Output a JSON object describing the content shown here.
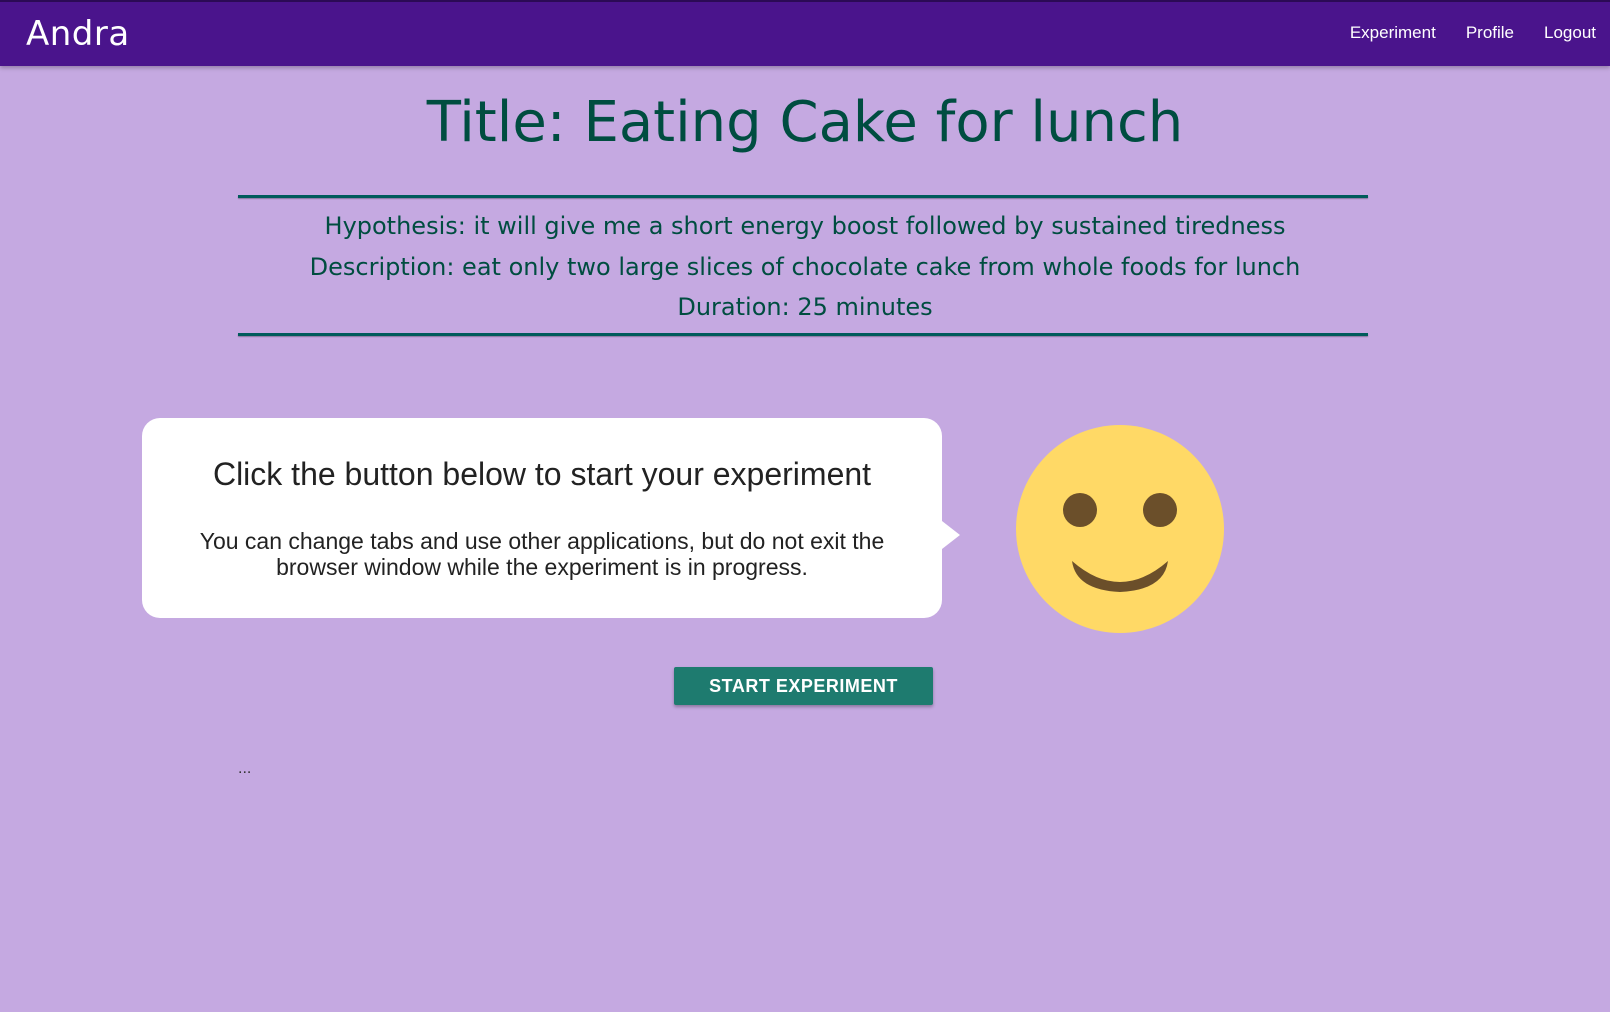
{
  "navbar": {
    "brand": "Andra",
    "links": [
      "Experiment",
      "Profile",
      "Logout"
    ]
  },
  "experiment": {
    "title": "Title: Eating Cake for lunch",
    "hypothesis": "Hypothesis: it will give me a short energy boost followed by sustained tiredness",
    "description": "Description: eat only two large slices of chocolate cake from whole foods for lunch",
    "duration": "Duration: 25 minutes"
  },
  "prompt": {
    "heading": "Click the button below to start your experiment",
    "text": "You can change tabs and use other applications, but do not exit the browser window while the experiment is in progress."
  },
  "mascot": {
    "icon": "smiley-face-icon",
    "face_color": "#ffd966",
    "feature_color": "#6b4f2a"
  },
  "actions": {
    "start_label": "START EXPERIMENT"
  },
  "status": {
    "ellipsis": "..."
  },
  "colors": {
    "background": "#c5a9e1",
    "navbar": "#4a148c",
    "heading_text": "#004d40",
    "button": "#1e7b6f"
  }
}
